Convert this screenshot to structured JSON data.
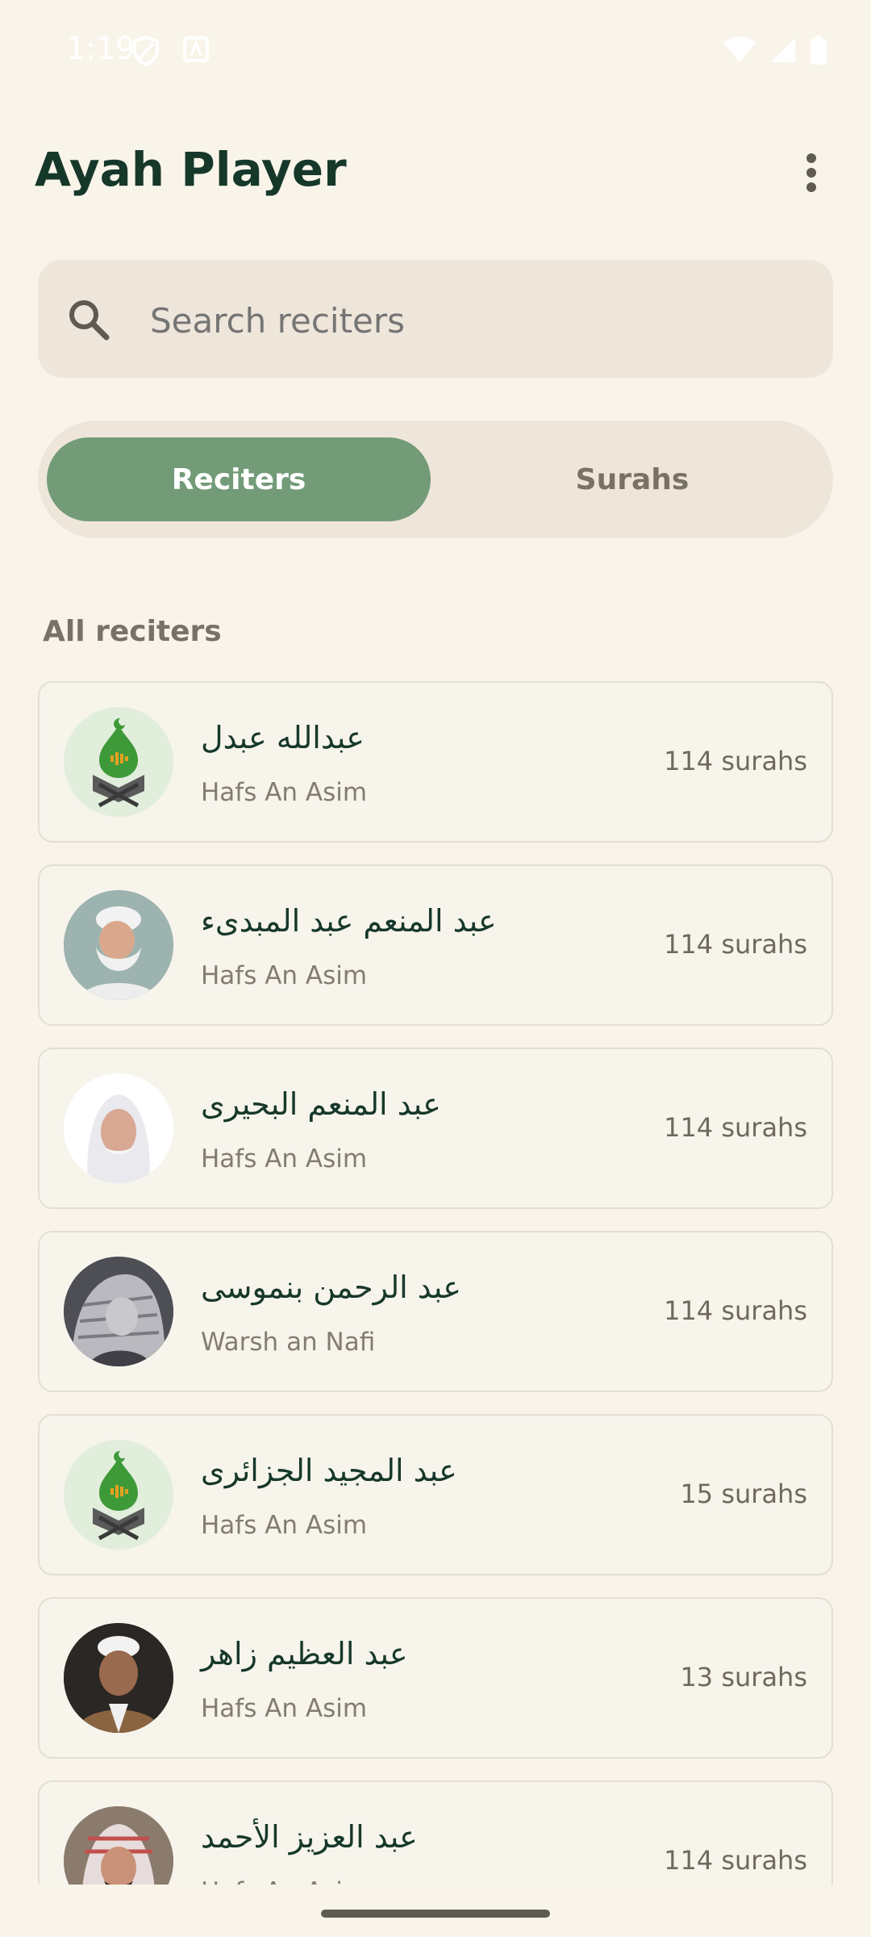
{
  "status_bar": {
    "time": "1:19",
    "icons": [
      "shield-icon",
      "a-badge-icon",
      "wifi-icon",
      "signal-icon",
      "battery-icon"
    ]
  },
  "app": {
    "title": "Ayah Player",
    "menu_icon": "more-vert-icon"
  },
  "search": {
    "placeholder": "Search reciters",
    "icon": "search-icon"
  },
  "tabs": [
    {
      "label": "Reciters",
      "active": true
    },
    {
      "label": "Surahs",
      "active": false
    }
  ],
  "section": {
    "label": "All reciters"
  },
  "reciters": [
    {
      "name": "عبدالله عبدل",
      "riwaya": "Hafs An Asim",
      "count": "114 surahs",
      "avatar": "placeholder-logo"
    },
    {
      "name": "عبد المنعم عبد المبدىء",
      "riwaya": "Hafs An Asim",
      "count": "114 surahs",
      "avatar": "photo"
    },
    {
      "name": "عبد المنعم البحيرى",
      "riwaya": "Hafs An Asim",
      "count": "114 surahs",
      "avatar": "photo"
    },
    {
      "name": "عبد الرحمن بنموسى",
      "riwaya": "Warsh an Nafi",
      "count": "114 surahs",
      "avatar": "photo"
    },
    {
      "name": "عبد المجيد الجزائرى",
      "riwaya": "Hafs An Asim",
      "count": "15 surahs",
      "avatar": "placeholder-logo"
    },
    {
      "name": "عبد العظيم زاهر",
      "riwaya": "Hafs An Asim",
      "count": "13 surahs",
      "avatar": "photo"
    },
    {
      "name": "عبد العزيز الأحمد",
      "riwaya": "Hafs An Asim",
      "count": "114 surahs",
      "avatar": "photo"
    }
  ],
  "colors": {
    "background": "#F9F4EA",
    "accent": "#739B78",
    "title": "#16382A"
  }
}
